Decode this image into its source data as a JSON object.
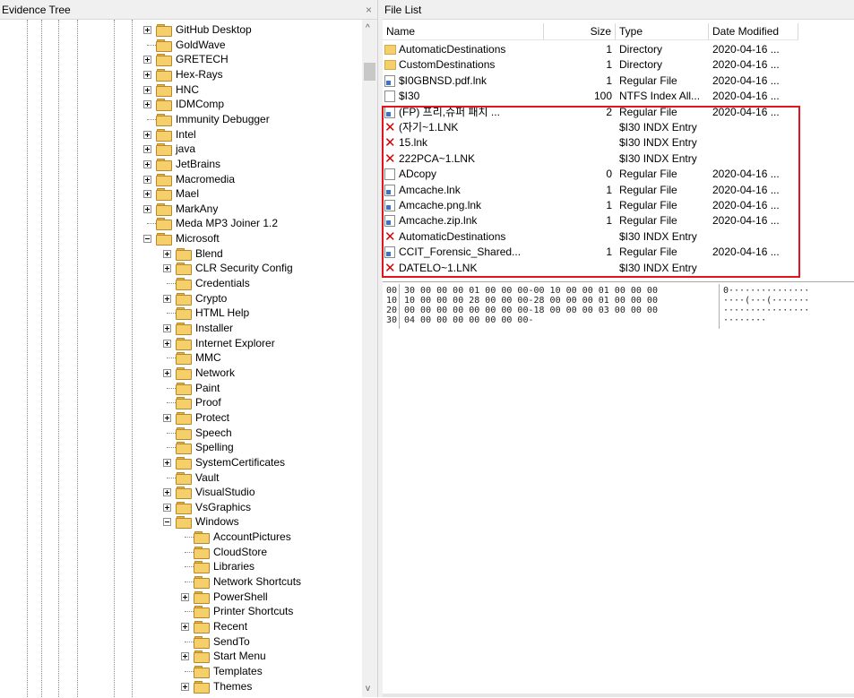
{
  "evidence_tree": {
    "title": "Evidence Tree",
    "close": "×",
    "scroll_up": "^",
    "scroll_down": "v",
    "nodes": [
      {
        "label": "GitHub Desktop",
        "expander": "plus"
      },
      {
        "label": "GoldWave",
        "expander": "none"
      },
      {
        "label": "GRETECH",
        "expander": "plus"
      },
      {
        "label": "Hex-Rays",
        "expander": "plus"
      },
      {
        "label": "HNC",
        "expander": "plus"
      },
      {
        "label": "IDMComp",
        "expander": "plus"
      },
      {
        "label": "Immunity Debugger",
        "expander": "none"
      },
      {
        "label": "Intel",
        "expander": "plus"
      },
      {
        "label": "java",
        "expander": "plus"
      },
      {
        "label": "JetBrains",
        "expander": "plus"
      },
      {
        "label": "Macromedia",
        "expander": "plus"
      },
      {
        "label": "Mael",
        "expander": "plus"
      },
      {
        "label": "MarkAny",
        "expander": "plus"
      },
      {
        "label": "Meda MP3 Joiner 1.2",
        "expander": "none"
      },
      {
        "label": "Microsoft",
        "expander": "minus"
      },
      {
        "label": "Blend",
        "expander": "plus"
      },
      {
        "label": "CLR Security Config",
        "expander": "plus"
      },
      {
        "label": "Credentials",
        "expander": "none"
      },
      {
        "label": "Crypto",
        "expander": "plus"
      },
      {
        "label": "HTML Help",
        "expander": "none"
      },
      {
        "label": "Installer",
        "expander": "plus"
      },
      {
        "label": "Internet Explorer",
        "expander": "plus"
      },
      {
        "label": "MMC",
        "expander": "none"
      },
      {
        "label": "Network",
        "expander": "plus"
      },
      {
        "label": "Paint",
        "expander": "none"
      },
      {
        "label": "Proof",
        "expander": "none"
      },
      {
        "label": "Protect",
        "expander": "plus"
      },
      {
        "label": "Speech",
        "expander": "none"
      },
      {
        "label": "Spelling",
        "expander": "none"
      },
      {
        "label": "SystemCertificates",
        "expander": "plus"
      },
      {
        "label": "Vault",
        "expander": "none"
      },
      {
        "label": "VisualStudio",
        "expander": "plus"
      },
      {
        "label": "VsGraphics",
        "expander": "plus"
      },
      {
        "label": "Windows",
        "expander": "minus"
      },
      {
        "label": "AccountPictures",
        "expander": "none"
      },
      {
        "label": "CloudStore",
        "expander": "none"
      },
      {
        "label": "Libraries",
        "expander": "none"
      },
      {
        "label": "Network Shortcuts",
        "expander": "none"
      },
      {
        "label": "PowerShell",
        "expander": "plus"
      },
      {
        "label": "Printer Shortcuts",
        "expander": "none"
      },
      {
        "label": "Recent",
        "expander": "plus"
      },
      {
        "label": "SendTo",
        "expander": "none"
      },
      {
        "label": "Start Menu",
        "expander": "plus"
      },
      {
        "label": "Templates",
        "expander": "none"
      },
      {
        "label": "Themes",
        "expander": "plus"
      }
    ]
  },
  "file_list": {
    "title": "File List",
    "columns": {
      "name": "Name",
      "size": "Size",
      "type": "Type",
      "date": "Date Modified"
    },
    "rows": [
      {
        "icon": "folder-icon",
        "name": "AutomaticDestinations",
        "size": "1",
        "type": "Directory",
        "date": "2020-04-16 ..."
      },
      {
        "icon": "folder-icon",
        "name": "CustomDestinations",
        "size": "1",
        "type": "Directory",
        "date": "2020-04-16 ..."
      },
      {
        "icon": "shortcut-file-icon",
        "name": "$I0GBNSD.pdf.lnk",
        "size": "1",
        "type": "Regular File",
        "date": "2020-04-16 ..."
      },
      {
        "icon": "file-icon",
        "name": "$I30",
        "size": "100",
        "type": "NTFS Index All...",
        "date": "2020-04-16 ..."
      },
      {
        "icon": "shortcut-file-icon",
        "name": "(FP) 프리,슈퍼 패치 ...",
        "size": "2",
        "type": "Regular File",
        "date": "2020-04-16 ..."
      },
      {
        "icon": "deleted-file-icon",
        "name": "(자기~1.LNK",
        "size": "",
        "type": "$I30 INDX Entry",
        "date": ""
      },
      {
        "icon": "deleted-file-icon",
        "name": "15.lnk",
        "size": "",
        "type": "$I30 INDX Entry",
        "date": ""
      },
      {
        "icon": "deleted-file-icon",
        "name": "222PCA~1.LNK",
        "size": "",
        "type": "$I30 INDX Entry",
        "date": ""
      },
      {
        "icon": "file-icon",
        "name": "ADcopy",
        "size": "0",
        "type": "Regular File",
        "date": "2020-04-16 ..."
      },
      {
        "icon": "shortcut-file-icon",
        "name": "Amcache.lnk",
        "size": "1",
        "type": "Regular File",
        "date": "2020-04-16 ..."
      },
      {
        "icon": "shortcut-file-icon",
        "name": "Amcache.png.lnk",
        "size": "1",
        "type": "Regular File",
        "date": "2020-04-16 ..."
      },
      {
        "icon": "shortcut-file-icon",
        "name": "Amcache.zip.lnk",
        "size": "1",
        "type": "Regular File",
        "date": "2020-04-16 ..."
      },
      {
        "icon": "deleted-file-icon",
        "name": "AutomaticDestinations",
        "size": "",
        "type": "$I30 INDX Entry",
        "date": ""
      },
      {
        "icon": "shortcut-file-icon",
        "name": "CCIT_Forensic_Shared...",
        "size": "1",
        "type": "Regular File",
        "date": "2020-04-16 ..."
      },
      {
        "icon": "deleted-file-icon",
        "name": "DATELO~1.LNK",
        "size": "",
        "type": "$I30 INDX Entry",
        "date": ""
      }
    ]
  },
  "hex_view": {
    "rows": [
      {
        "offset": "00",
        "bytes": "30 00 00 00 01 00 00 00-00 10 00 00 01 00 00 00",
        "ascii": "0···············"
      },
      {
        "offset": "10",
        "bytes": "10 00 00 00 28 00 00 00-28 00 00 00 01 00 00 00",
        "ascii": "····(···(·······"
      },
      {
        "offset": "20",
        "bytes": "00 00 00 00 00 00 00 00-18 00 00 00 03 00 00 00",
        "ascii": "················"
      },
      {
        "offset": "30",
        "bytes": "04 00 00 00 00 00 00 00-",
        "ascii": "········"
      }
    ]
  },
  "colors": {
    "highlight_border": "#e2151f",
    "folder": "#f4cf6a",
    "deleted_mark": "#d40000"
  }
}
